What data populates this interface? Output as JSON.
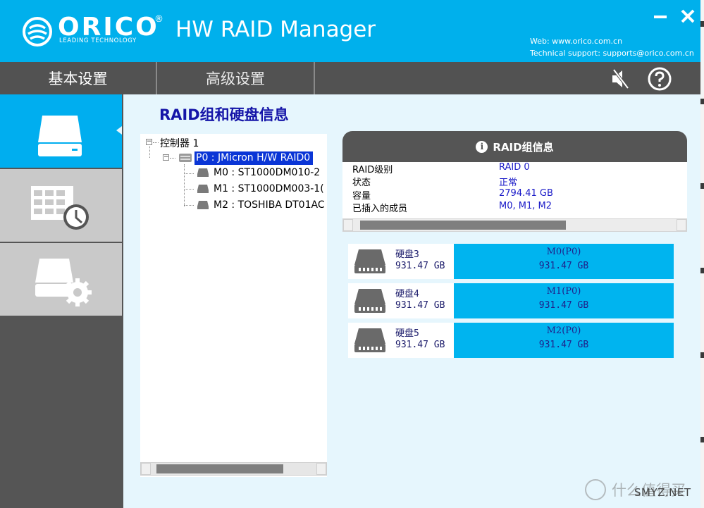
{
  "header": {
    "brand": "ORICO",
    "registered": "®",
    "tagline": "LEADING TECHNOLOGY",
    "app_title": "HW RAID Manager",
    "web": "Web: www.orico.com.cn",
    "support": "Technical support: supports@orico.com.cn",
    "minimize_label": "−",
    "close_label": "✕",
    "bg_color": "#00b0ec"
  },
  "tabs": [
    {
      "label": "基本设置",
      "active": true
    },
    {
      "label": "高级设置",
      "active": false
    }
  ],
  "nav_icons": [
    "mute-icon",
    "help-icon"
  ],
  "sidebar": {
    "items": [
      {
        "icon": "disk-icon",
        "active": true
      },
      {
        "icon": "raid-table-clock-icon",
        "active": false
      },
      {
        "icon": "disk-settings-icon",
        "active": false
      }
    ]
  },
  "main": {
    "title": "RAID组和硬盘信息"
  },
  "tree": {
    "controller": "控制器 1",
    "raid": "P0 : JMicron H/W RAID0",
    "members": [
      "M0 : ST1000DM010-2",
      "M1 : ST1000DM003-1(",
      "M2 : TOSHIBA DT01AC"
    ]
  },
  "raid_info": {
    "heading": "RAID组信息",
    "rows": [
      {
        "label": "RAID级别",
        "value": "RAID 0"
      },
      {
        "label": "状态",
        "value": "正常"
      },
      {
        "label": "容量",
        "value": "2794.41 GB"
      },
      {
        "label": "已插入的成员",
        "value": "M0, M1, M2"
      }
    ]
  },
  "disks": [
    {
      "name": "硬盘3",
      "size": "931.47 GB",
      "member": "M0(P0)",
      "member_size": "931.47 GB"
    },
    {
      "name": "硬盘4",
      "size": "931.47 GB",
      "member": "M1(P0)",
      "member_size": "931.47 GB"
    },
    {
      "name": "硬盘5",
      "size": "931.47 GB",
      "member": "M2(P0)",
      "member_size": "931.47 GB"
    }
  ],
  "watermark": {
    "text": "什么值得买",
    "site": "SMYZ.NET"
  },
  "colors": {
    "accent": "#00b0ec",
    "nav": "#525252",
    "selection": "#0a35d6",
    "bar": "#00b4ef"
  }
}
